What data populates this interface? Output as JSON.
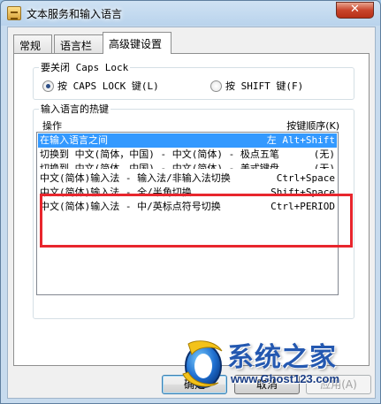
{
  "window": {
    "title": "文本服务和输入语言",
    "close_label": "✕"
  },
  "tabs": [
    {
      "label": "常规",
      "active": false
    },
    {
      "label": "语言栏",
      "active": false
    },
    {
      "label": "高级键设置",
      "active": true
    }
  ],
  "capslock": {
    "group_label": "要关闭 Caps Lock",
    "options": [
      {
        "label": "按 CAPS LOCK 键(L)",
        "checked": true
      },
      {
        "label": "按 SHIFT 键(F)",
        "checked": false
      }
    ]
  },
  "hotkeys": {
    "group_label": "输入语言的热键",
    "col_action": "操作",
    "col_key": "按键顺序(K)",
    "rows": [
      {
        "action": "在输入语言之间",
        "key": "左 Alt+Shift",
        "selected": true
      },
      {
        "action": "切换到 中文(简体，中国) - 中文(简体) - 极点五笔",
        "key": "(无)",
        "selected": false
      },
      {
        "action": "切换到 中文(简体，中国) - 中文(简体) - 美式键盘",
        "key": "(无)",
        "selected": false
      },
      {
        "action": "中文(简体)输入法 - 输入法/非输入法切换",
        "key": "Ctrl+Space",
        "selected": false
      },
      {
        "action": "中文(简体)输入法 - 全/半角切换",
        "key": "Shift+Space",
        "selected": false
      },
      {
        "action": "中文(简体)输入法 - 中/英标点符号切换",
        "key": "Ctrl+PERIOD",
        "selected": false
      }
    ]
  },
  "watermark": {
    "brand": "系统之家",
    "url": "www.Ghost123.com"
  },
  "buttons": {
    "ok": "确定",
    "cancel": "取消",
    "apply": "应用(A)"
  }
}
